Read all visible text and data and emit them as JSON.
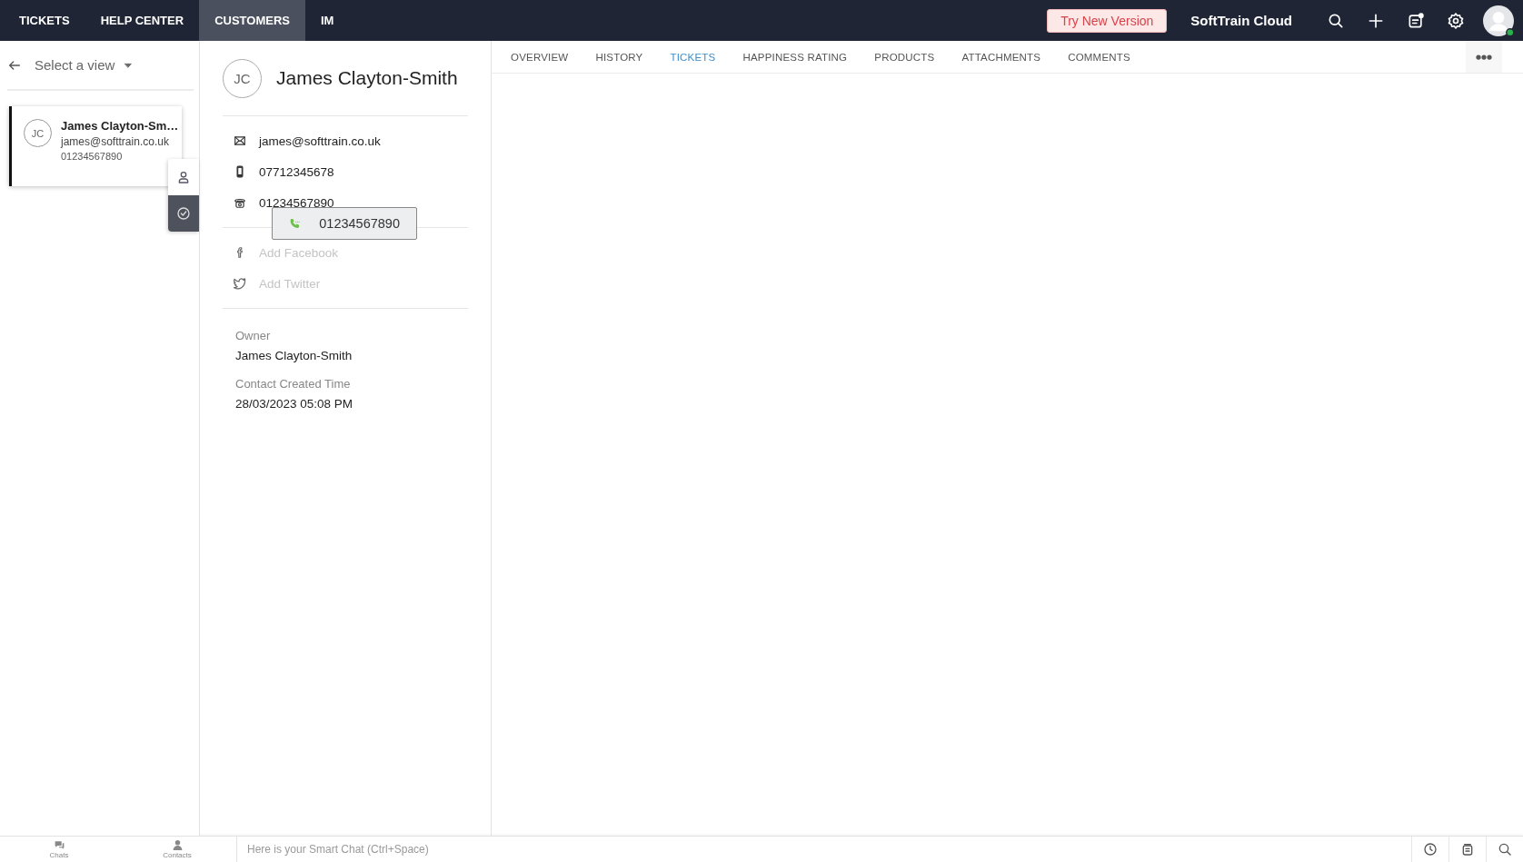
{
  "top_nav": {
    "items": [
      {
        "label": "TICKETS",
        "selected": false
      },
      {
        "label": "HELP CENTER",
        "selected": false
      },
      {
        "label": "CUSTOMERS",
        "selected": true
      },
      {
        "label": "IM",
        "selected": false
      }
    ],
    "try_button": "Try New Version",
    "org_name": "SoftTrain Cloud"
  },
  "sidebar": {
    "view_selector": "Select a view",
    "contacts": [
      {
        "initials": "JC",
        "name": "James Clayton-Sm…",
        "email": "james@softtrain.co.uk",
        "phone": "01234567890",
        "selected": true
      }
    ]
  },
  "contact": {
    "initials": "JC",
    "name": "James Clayton-Smith",
    "fields": [
      {
        "kind": "email",
        "value": "james@softtrain.co.uk"
      },
      {
        "kind": "mobile",
        "value": "07712345678"
      },
      {
        "kind": "phone",
        "value": "01234567890"
      }
    ],
    "social": [
      {
        "kind": "facebook",
        "placeholder": "Add Facebook"
      },
      {
        "kind": "twitter",
        "placeholder": "Add Twitter"
      }
    ],
    "details": [
      {
        "label": "Owner",
        "value": "James Clayton-Smith"
      },
      {
        "label": "Contact Created Time",
        "value": "28/03/2023 05:08 PM"
      }
    ],
    "call_tooltip": "01234567890"
  },
  "tabs": [
    {
      "label": "OVERVIEW",
      "selected": false
    },
    {
      "label": "HISTORY",
      "selected": false
    },
    {
      "label": "TICKETS",
      "selected": true
    },
    {
      "label": "HAPPINESS RATING",
      "selected": false
    },
    {
      "label": "PRODUCTS",
      "selected": false
    },
    {
      "label": "ATTACHMENTS",
      "selected": false
    },
    {
      "label": "COMMENTS",
      "selected": false
    }
  ],
  "bottom_bar": {
    "items": [
      {
        "kind": "chats",
        "label": "Chats"
      },
      {
        "kind": "contacts",
        "label": "Contacts"
      }
    ],
    "smart_chat": {
      "placeholder": "Here is your Smart Chat (Ctrl+Space)"
    }
  }
}
